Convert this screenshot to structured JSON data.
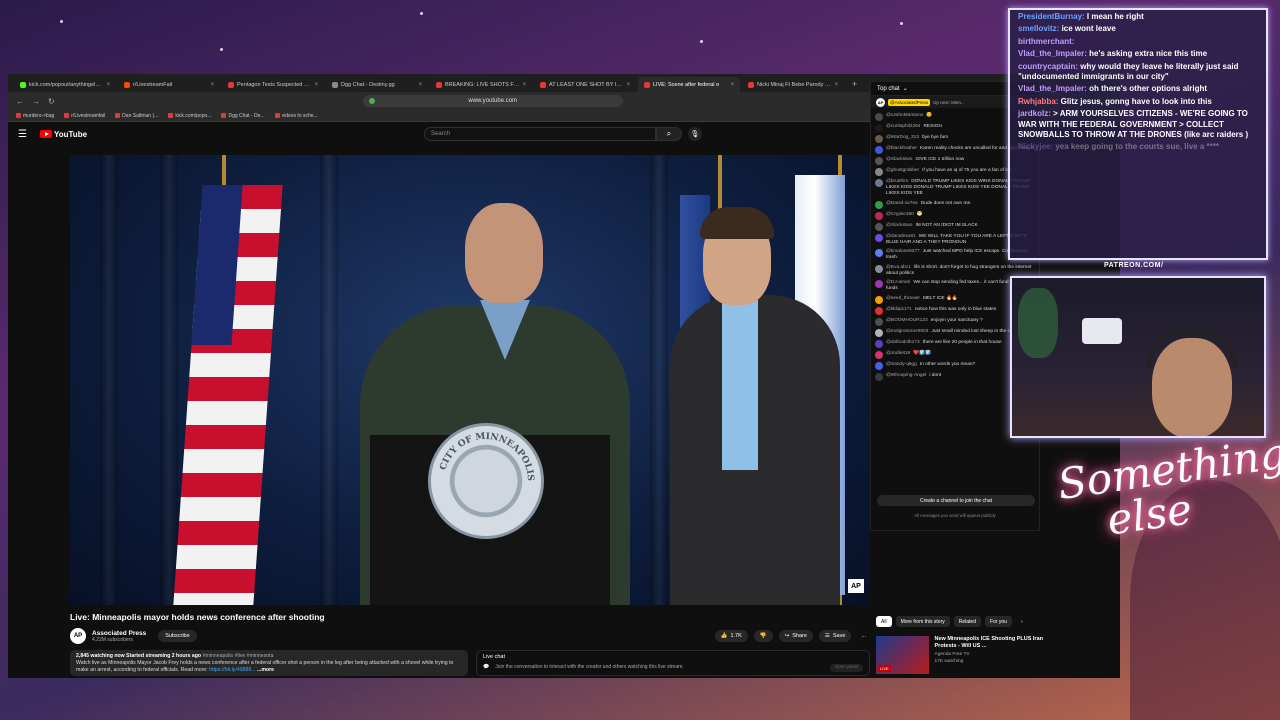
{
  "browser": {
    "tabs": [
      {
        "label": "kick.com/popout/anythingelse/chat",
        "color": "#53fc18",
        "active": false
      },
      {
        "label": "r/LivestreamFail",
        "color": "#ff4500",
        "active": false
      },
      {
        "label": "Pentagon Tests Suspected Havana",
        "color": "#e53935",
        "active": false
      },
      {
        "label": "Dgg Chat - Destiny.gg",
        "color": "#888888",
        "active": false
      },
      {
        "label": "BREAKING: LIVE SHOTS FIRED AT M",
        "color": "#e53935",
        "active": false
      },
      {
        "label": "AT LEAST ONE SHOT BY ICE IN MN",
        "color": "#e53935",
        "active": false
      },
      {
        "label": "LIVE: Scene after federal o",
        "color": "#e53935",
        "active": true
      },
      {
        "label": "Nicki Minaj Ft Bebe Parody Naked",
        "color": "#e53935",
        "active": false
      }
    ],
    "url": "www.youtube.com",
    "bookmarks": [
      "murders->bag",
      "r/Livestreamfail",
      "Dan Saltman (...",
      "kick.com/popo...",
      "Dgg Chat - De...",
      "videos to sche..."
    ]
  },
  "youtube": {
    "logo_text": "YouTube",
    "search_placeholder": "Search",
    "video": {
      "title": "Live: Minneapolis mayor holds news conference after shooting",
      "bug": "AP",
      "seal_text": "CITY OF MINNEAPOLIS"
    },
    "channel": {
      "avatar": "AP",
      "name": "Associated Press",
      "subscribers": "4.22M subscribers",
      "subscribe_label": "Subscribe"
    },
    "actions": {
      "likes": "1.7K",
      "share": "Share",
      "save": "Save",
      "more": "..."
    },
    "description": {
      "stats": "2,845 watching now  Started streaming 2 hours ago",
      "tags": "#minneapolis #live #minnesota",
      "text": "Watch live as Minneapolis Mayor Jacob Frey holds a news conference after a federal officer shot a person in the leg after being attacked with a shovel while trying to make an arrest, according to federal officials. Read more:",
      "link": "https://bit.ly/49888...",
      "more": "...more"
    },
    "live_chat_box": {
      "title": "Live chat",
      "text": "Join the conversation to interact with the creator and others watching this live stream.",
      "button": "Open panel"
    },
    "chat": {
      "header": "Top chat",
      "pinned_tag": "@AssociatedPress",
      "pinned_next": "Up next: Minn...",
      "messages": [
        {
          "user": "@xJohnMarstonx",
          "text": "😊",
          "color": "#4a4a4a"
        },
        {
          "user": "@curtisphil2264",
          "text": "RESIGN",
          "color": "#1a1a1a"
        },
        {
          "user": "@WarDog_313",
          "text": "bye bye fam",
          "color": "#6b5a4a"
        },
        {
          "user": "@blackfeather",
          "text": "Karen reality checks are uncalled for and right tonight",
          "color": "#3b5bdb"
        },
        {
          "user": "@Slackstwo",
          "text": "GIVE ICE 1 trillion now",
          "color": "#555555"
        },
        {
          "user": "@ghostgrabber",
          "text": "If you have an iq of 75 you are a fan of ice",
          "color": "#888888"
        },
        {
          "user": "@brusthm",
          "text": "DONALD TRUMP LIKES KIDS WINS DONALD TRUMP LIKES KIDS DONALD TRUMP LIKES KIDS YEE DONALD TRUMP LIKES KIDS YEE",
          "color": "#6b7a8f"
        },
        {
          "user": "@David-ox7ee",
          "text": "Dude does not own me.",
          "color": "#2f9e44"
        },
        {
          "user": "@Cryptic480",
          "text": "😁",
          "color": "#c2255c"
        },
        {
          "user": "@Slackstwo",
          "text": "IM NOT AN IDIOT IM SLACK",
          "color": "#555555"
        },
        {
          "user": "@danafexx81",
          "text": "WE WILL TAKE YOU IF YOU ARE A LEFTIE WITH BLUE HAIR AND A THEY PRONOUN",
          "color": "#7048e8"
        },
        {
          "user": "@kmalone9377",
          "text": "Just watched MPD help ICE escape. Collaborator trash.",
          "color": "#5c7cfa"
        },
        {
          "user": "@Eva.abc1",
          "text": "life is short. don't forget to hug strangers on the internet about politics",
          "color": "#868e96"
        },
        {
          "user": "@DJ-amari",
          "text": "We can stop sending fed taxes... it can't fund with no funds",
          "color": "#9c36b5"
        },
        {
          "user": "@seed_thrower",
          "text": "MELT ICE 🔥🔥",
          "color": "#f59f00"
        },
        {
          "user": "@lildiqi1171",
          "text": "notice how this was only in blue states",
          "color": "#e03131"
        },
        {
          "user": "@BOOMHOUR123",
          "text": "enjoyin your sanctuary ?",
          "color": "#495057"
        },
        {
          "user": "@molgrommer9003",
          "text": "Just small minded lost sheep in the chat",
          "color": "#adb5bd"
        },
        {
          "user": "@dolbodolb173",
          "text": "there are like 20 people in that house",
          "color": "#5f3dc4"
        },
        {
          "user": "@Jodle819",
          "text": "❤️🧊🧊",
          "color": "#d6336c"
        },
        {
          "user": "@Sandy-q5gg",
          "text": "In other words you mean?",
          "color": "#4263eb"
        },
        {
          "user": "@Whooping-Angel",
          "text": "i dont",
          "color": "#343a40"
        }
      ],
      "create_channel": "Create a channel to join the chat",
      "public_note": "All messages you send will appear publicly"
    },
    "chips": [
      "All",
      "More from this story",
      "Related",
      "For you"
    ],
    "related": {
      "title": "New Minneapolis ICE Shooting PLUS Iran Protests - Will US ...",
      "channel": "Agenda Free TV",
      "meta": "17K watching",
      "live_badge": "LIVE"
    }
  },
  "stream_overlay": {
    "chat": [
      {
        "user": "PresidentBurnay",
        "text": "I mean he right",
        "cls": "blue",
        "faded": false
      },
      {
        "user": "smellovitz",
        "text": "ice wont leave",
        "cls": "blue",
        "faded": false
      },
      {
        "user": "birthmerchant",
        "text": "",
        "cls": "",
        "faded": false
      },
      {
        "user": "Vlad_the_Impaler",
        "text": "he's asking extra nice this time",
        "cls": "",
        "faded": false
      },
      {
        "user": "countrycaptain",
        "text": "why would they leave he literally just said \"undocumented immigrants in our city\"",
        "cls": "",
        "faded": false
      },
      {
        "user": "Vlad_the_Impaler",
        "text": "oh there's other options alright",
        "cls": "",
        "faded": false
      },
      {
        "user": "Rwhjabba",
        "text": "Glitz jesus, gonng have to look into this",
        "cls": "red",
        "faded": false
      },
      {
        "user": "jardkolz",
        "text": "> ARM YOURSELVES CITIZENS - WE'RE GOING TO WAR WITH THE FEDERAL GOVERNMENT > COLLECT SNOWBALLS TO THROW AT THE DRONES (like arc raiders )",
        "cls": "",
        "faded": false
      },
      {
        "user": "Nickyjee",
        "text": "yea keep going to the courts sue, live a ****",
        "cls": "",
        "faded": true
      }
    ],
    "patreon": "PATREON.COM/",
    "neon_line1": "Something",
    "neon_line2": "else"
  }
}
